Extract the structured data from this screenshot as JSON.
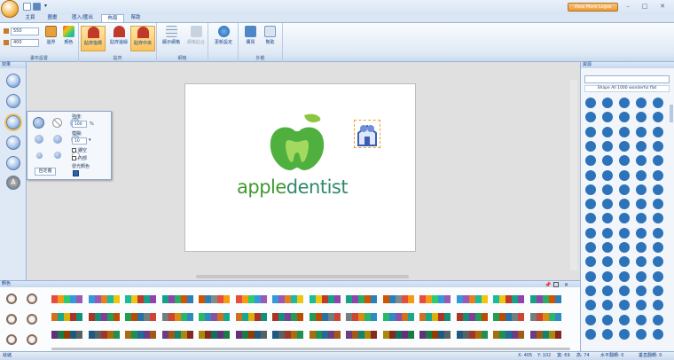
{
  "titlebar": {
    "view_more_logos": "View More Logos"
  },
  "tabs": [
    "主頁",
    "圖畫",
    "匯入/匯出",
    "佈局",
    "幫助"
  ],
  "ribbon": {
    "size_w": "550",
    "size_h": "400",
    "buttons": {
      "border": "邊界",
      "color": "顏色",
      "snap_guide": "貼齊指標",
      "snap_edge": "貼齊邊緣",
      "snap_center": "貼齊中央",
      "show_grid": "顯示網格",
      "snap_grid": "網格貼合",
      "update": "更新設定",
      "register": "購買",
      "help": "幫助"
    },
    "groups": [
      "畫布設置",
      "貼齊",
      "網格",
      "",
      "外觀"
    ]
  },
  "left_panel": {
    "title": "效果"
  },
  "popup": {
    "strength_label": "強度:",
    "strength_value": "100",
    "strength_unit": "%",
    "blur_label": "模糊:",
    "blur_value": "10",
    "hollow": "鏤空",
    "inner": "內部",
    "glow_color": "發光顏色",
    "custom_button": "自定義"
  },
  "logo": {
    "text_left": "apple",
    "text_right": "dentist"
  },
  "resources": {
    "title": "資源",
    "search_placeholder": "",
    "filter": "Shape All 1000 wonderful flat"
  },
  "color_panel": {
    "title": "顏色"
  },
  "status": {
    "left": "就緒",
    "x": "X: 405",
    "y": "Y: 102",
    "width": "寬: 69",
    "height": "高: 74",
    "hflip": "水平翻轉: 0",
    "vflip": "垂直翻轉: 0"
  },
  "colors": {
    "logo_green": "#5db33f",
    "logo_green_dark": "#3f9a2e",
    "text_blue": "#2c8a3f",
    "accent": "#2d73ba"
  }
}
